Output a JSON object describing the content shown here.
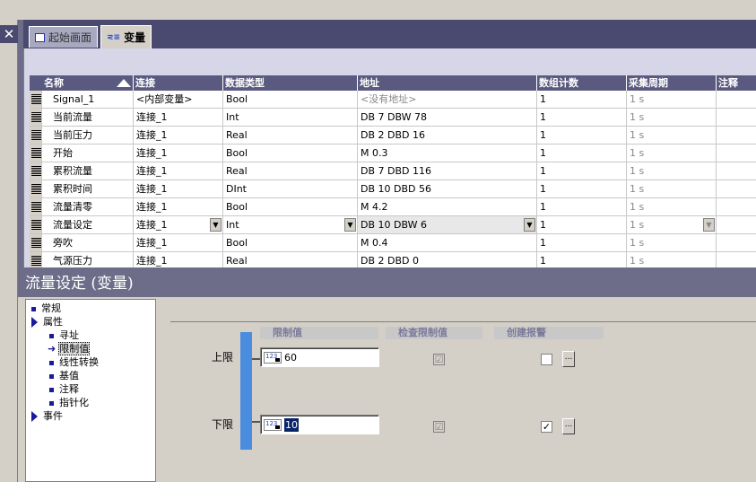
{
  "tabs": [
    {
      "label": "起始画面"
    },
    {
      "label": "变量"
    }
  ],
  "table": {
    "headers": [
      "名称",
      "连接",
      "数据类型",
      "地址",
      "数组计数",
      "采集周期",
      "注释"
    ],
    "rows": [
      [
        "Signal_1",
        "<内部变量>",
        "Bool",
        "<没有地址>",
        "1",
        "1 s"
      ],
      [
        "当前流量",
        "连接_1",
        "Int",
        "DB 7 DBW 78",
        "1",
        "1 s"
      ],
      [
        "当前压力",
        "连接_1",
        "Real",
        "DB 2 DBD 16",
        "1",
        "1 s"
      ],
      [
        "开始",
        "连接_1",
        "Bool",
        "M 0.3",
        "1",
        "1 s"
      ],
      [
        "累积流量",
        "连接_1",
        "Real",
        "DB 7 DBD 116",
        "1",
        "1 s"
      ],
      [
        "累积时间",
        "连接_1",
        "DInt",
        "DB 10 DBD 56",
        "1",
        "1 s"
      ],
      [
        "流量清零",
        "连接_1",
        "Bool",
        "M 4.2",
        "1",
        "1 s"
      ],
      [
        "流量设定",
        "连接_1",
        "Int",
        "DB 10 DBW 6",
        "1",
        "1 s"
      ],
      [
        "旁吹",
        "连接_1",
        "Bool",
        "M 0.4",
        "1",
        "1 s"
      ],
      [
        "气源压力",
        "连接_1",
        "Real",
        "DB 2 DBD 0",
        "1",
        "1 s"
      ]
    ]
  },
  "properties": {
    "title": "流量设定 (变量)",
    "nav": {
      "general": "常规",
      "props": "属性",
      "addressing": "寻址",
      "limits": "限制值",
      "linear": "线性转换",
      "start_value": "基值",
      "comment": "注释",
      "pointer": "指针化",
      "events": "事件"
    },
    "limits": {
      "col_limit": "限制值",
      "col_check": "检查限制值",
      "col_alarm": "创建报警",
      "upper_label": "上限",
      "lower_label": "下限",
      "upper_value": "60",
      "lower_value": "10",
      "icon_text": "123",
      "upper_check": "☑",
      "lower_check": "☑",
      "upper_alarm": "",
      "lower_alarm": "✓",
      "dots": "..."
    }
  },
  "colors": {
    "header_bg": "#5a5a80",
    "accent_bar": "#4a8cdf",
    "selection": "#0a246a"
  }
}
